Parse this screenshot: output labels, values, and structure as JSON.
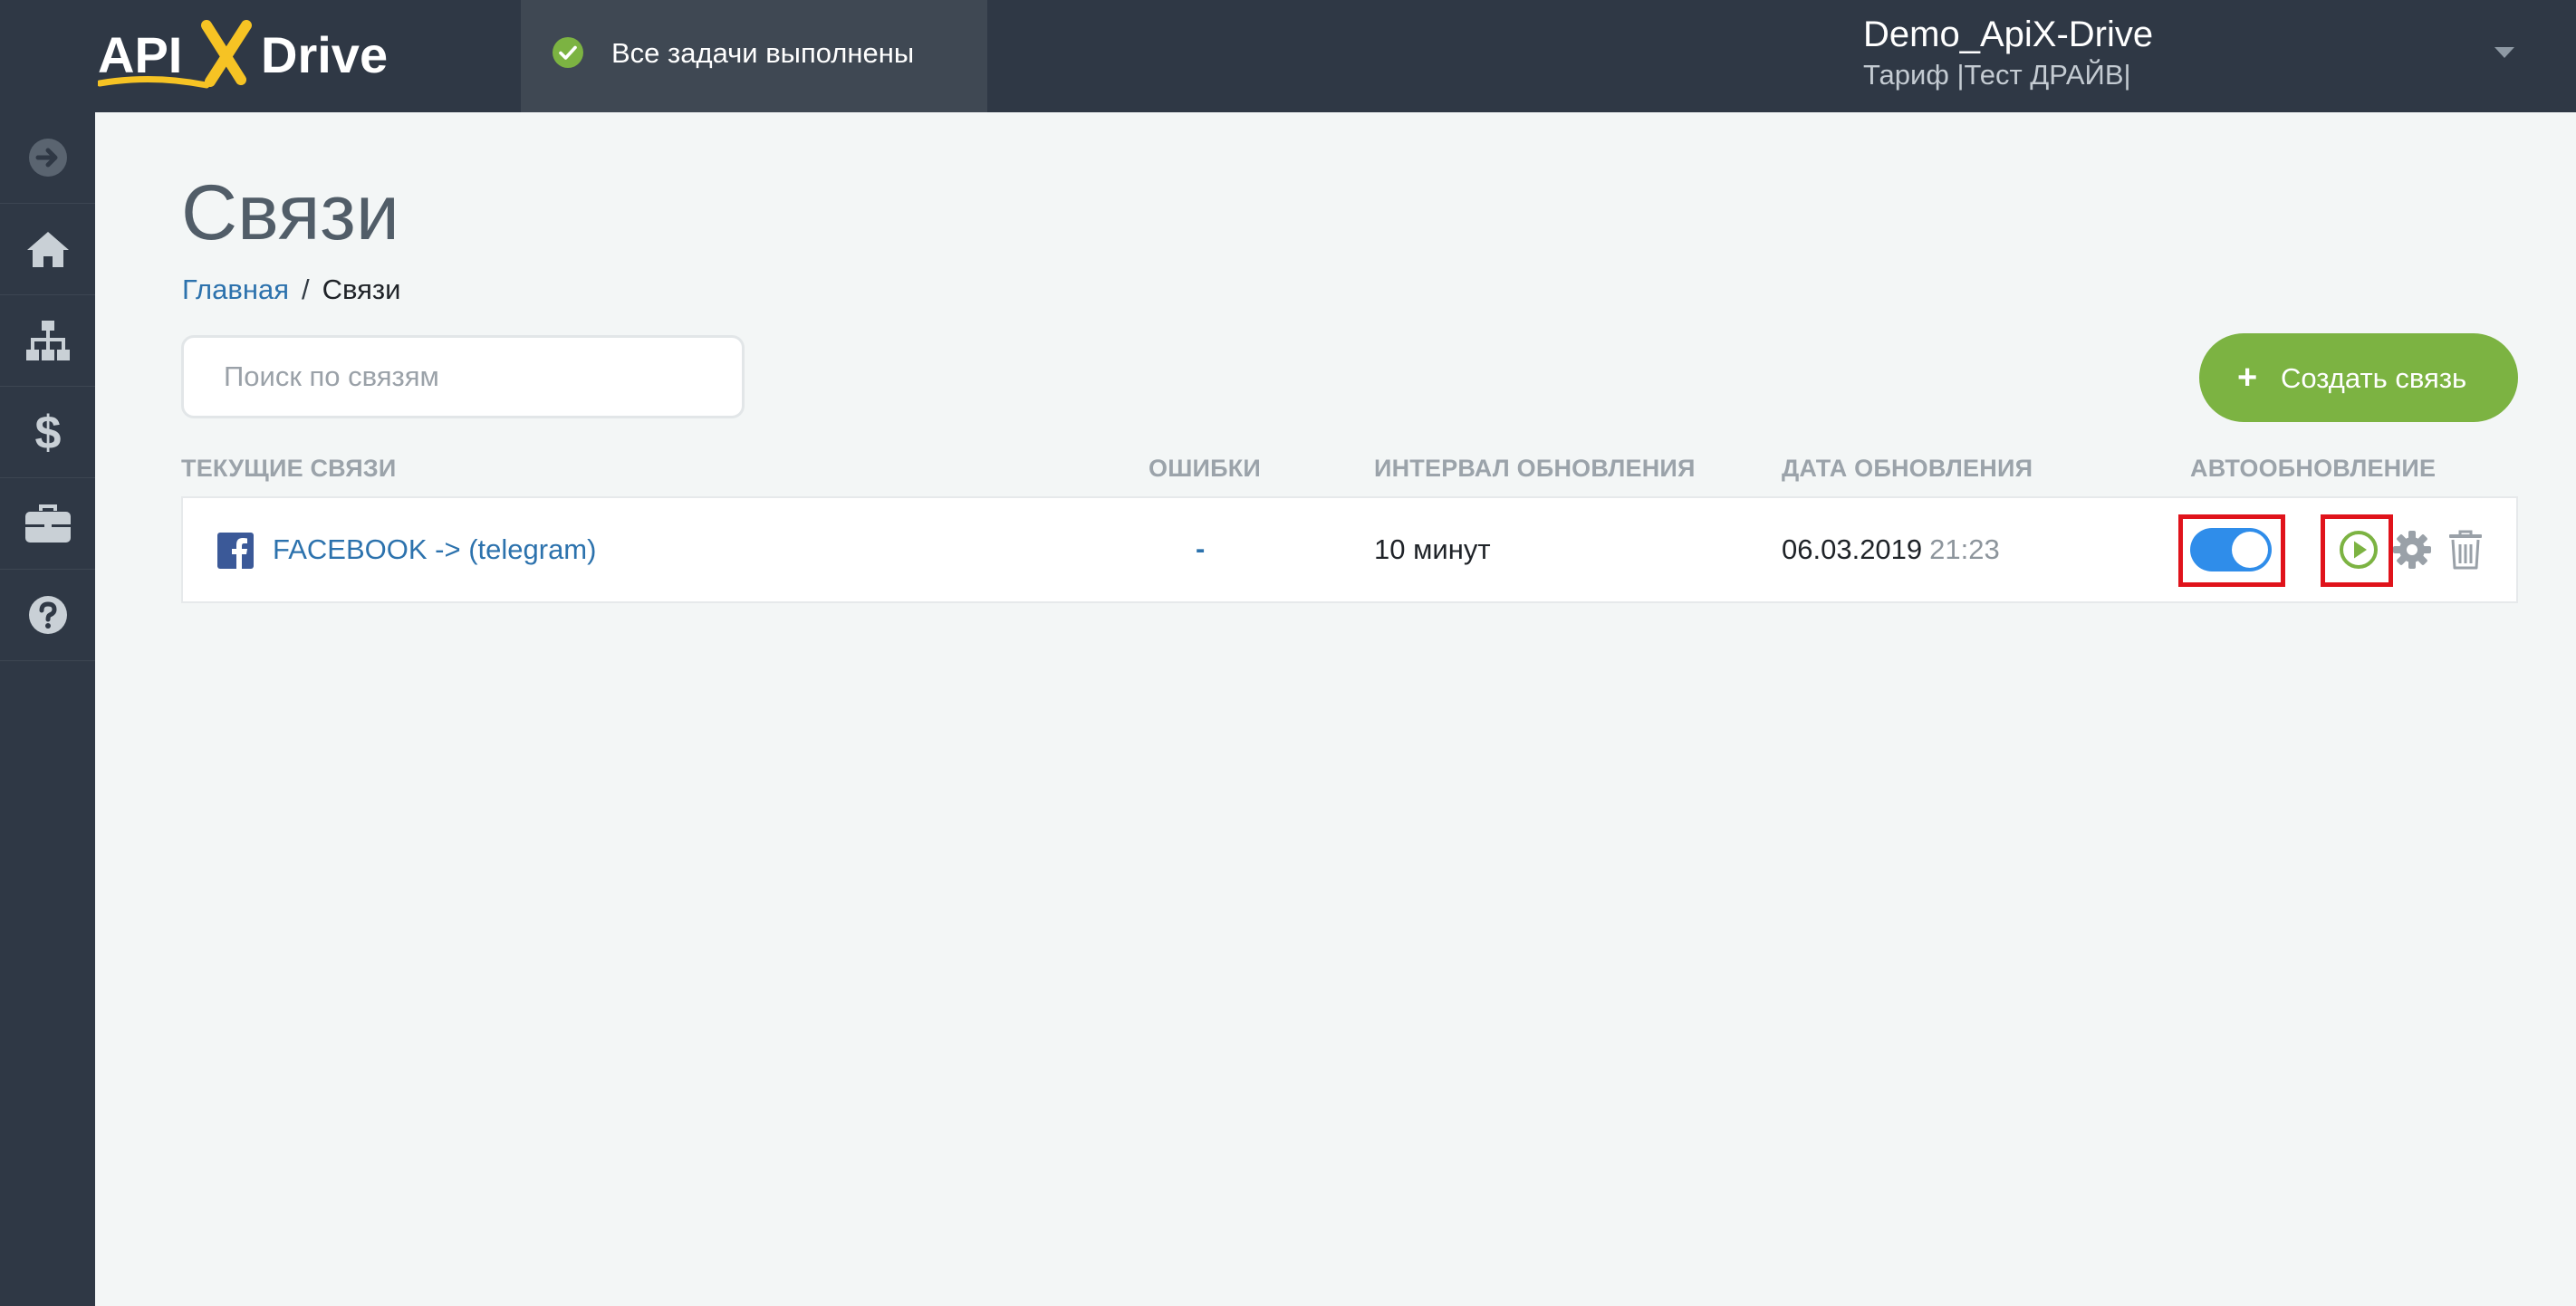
{
  "header": {
    "logo_text": "APIXDrive",
    "status_text": "Все задачи выполнены",
    "user_name": "Demo_ApiX-Drive",
    "user_plan": "Тариф |Тест ДРАЙВ|"
  },
  "sidebar": {
    "items": [
      {
        "icon": "arrow-right-circle-icon"
      },
      {
        "icon": "home-icon"
      },
      {
        "icon": "sitemap-icon"
      },
      {
        "icon": "dollar-icon"
      },
      {
        "icon": "briefcase-icon"
      },
      {
        "icon": "question-circle-icon"
      }
    ]
  },
  "page": {
    "title": "Связи",
    "breadcrumb": {
      "home": "Главная",
      "separator": "/",
      "current": "Связи"
    }
  },
  "search": {
    "placeholder": "Поиск по связям"
  },
  "toolbar": {
    "create_plus": "+",
    "create_label": "Создать связь"
  },
  "table": {
    "columns": [
      "ТЕКУЩИЕ СВЯЗИ",
      "ОШИБКИ",
      "ИНТЕРВАЛ ОБНОВЛЕНИЯ",
      "ДАТА ОБНОВЛЕНИЯ",
      "АВТООБНОВЛЕНИЕ"
    ],
    "rows": [
      {
        "name": "FACEBOOK -> (telegram)",
        "errors": "-",
        "interval": "10 минут",
        "date": "06.03.2019",
        "time": "21:23",
        "autoupdate": true
      }
    ]
  },
  "colors": {
    "topbar": "#2f3845",
    "accent_green": "#7cb342",
    "link_blue": "#2c72ad",
    "toggle_blue": "#2f8dea",
    "highlight_red": "#e0131b"
  }
}
